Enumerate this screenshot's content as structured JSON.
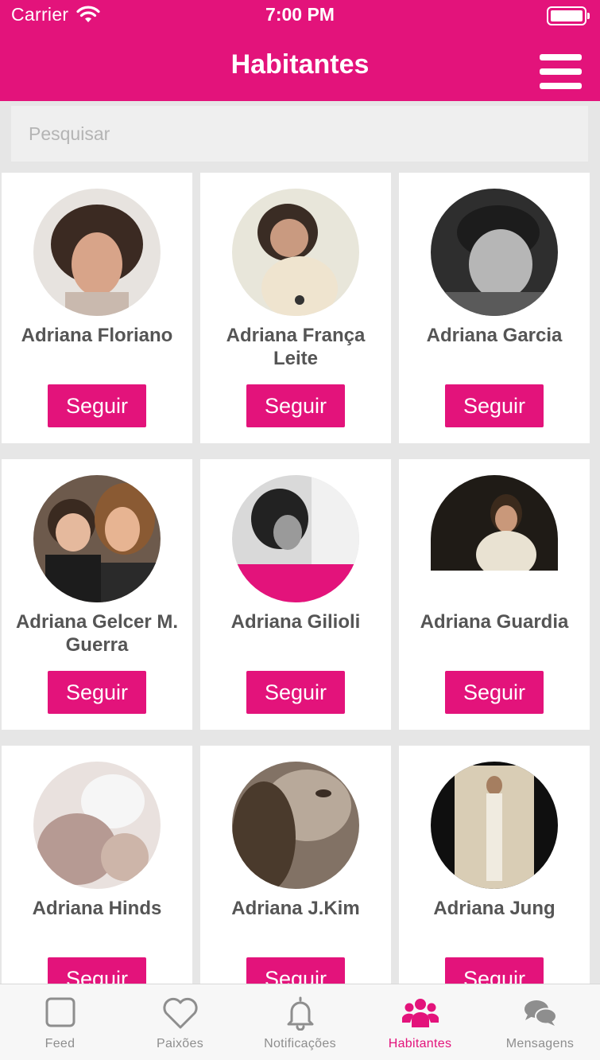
{
  "status_bar": {
    "carrier": "Carrier",
    "time": "7:00 PM"
  },
  "nav": {
    "title": "Habitantes"
  },
  "search": {
    "placeholder": "Pesquisar"
  },
  "colors": {
    "accent": "#e3137b",
    "inactive": "#8e8e8e"
  },
  "people": [
    {
      "name": "Adriana Floriano",
      "button": "Seguir"
    },
    {
      "name": "Adriana França Leite",
      "button": "Seguir"
    },
    {
      "name": "Adriana Garcia",
      "button": "Seguir"
    },
    {
      "name": "Adriana Gelcer M. Guerra",
      "button": "Seguir"
    },
    {
      "name": "Adriana Gilioli",
      "button": "Seguir"
    },
    {
      "name": "Adriana Guardia",
      "button": "Seguir"
    },
    {
      "name": "Adriana Hinds",
      "button": "Seguir"
    },
    {
      "name": "Adriana J.Kim",
      "button": "Seguir"
    },
    {
      "name": "Adriana Jung",
      "button": "Seguir"
    }
  ],
  "tabbar": {
    "items": [
      {
        "label": "Feed",
        "icon": "square-icon"
      },
      {
        "label": "Paixões",
        "icon": "heart-icon"
      },
      {
        "label": "Notificações",
        "icon": "bell-icon"
      },
      {
        "label": "Habitantes",
        "icon": "people-icon",
        "active": true
      },
      {
        "label": "Mensagens",
        "icon": "chat-bubbles-icon"
      }
    ]
  }
}
